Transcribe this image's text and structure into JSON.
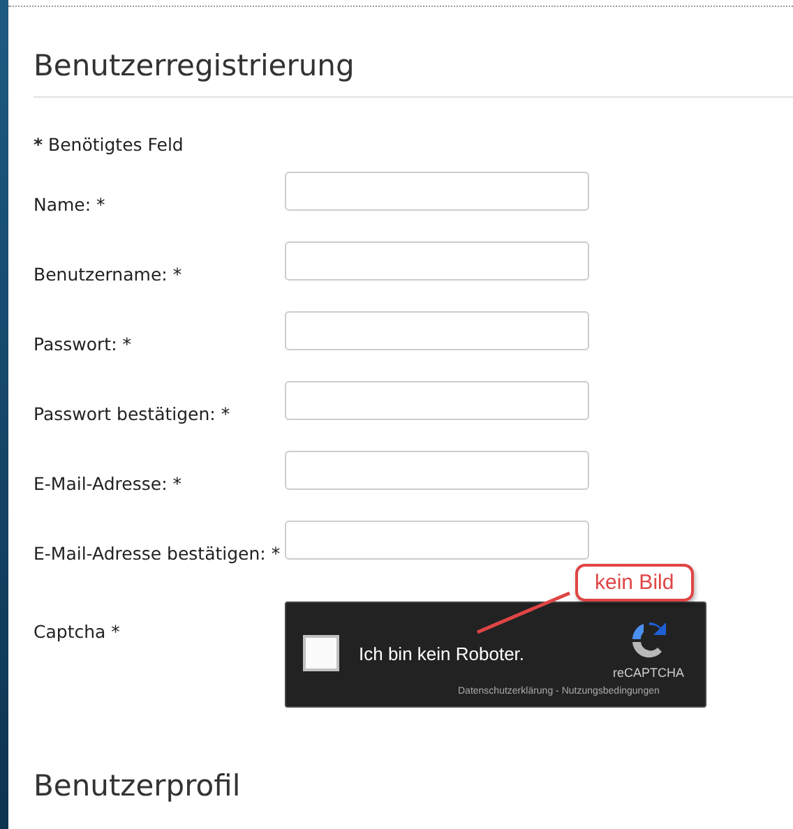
{
  "heading": "Benutzerregistrierung",
  "required_note": {
    "mark": "*",
    "text": "Benötigtes Feld"
  },
  "fields": [
    {
      "label": "Name: *"
    },
    {
      "label": "Benutzername: *"
    },
    {
      "label": "Passwort: *"
    },
    {
      "label": "Passwort bestätigen: *"
    },
    {
      "label": "E-Mail-Adresse: *"
    },
    {
      "label": "E-Mail-Adresse bestätigen: *"
    }
  ],
  "captcha": {
    "label": "Captcha *",
    "checked": false,
    "text": "Ich bin kein Roboter.",
    "brand": "reCAPTCHA",
    "links": "Datenschutzerklärung - Nutzungsbedingungen",
    "callout": "kein Bild"
  },
  "next_heading": "Benutzerprofil"
}
